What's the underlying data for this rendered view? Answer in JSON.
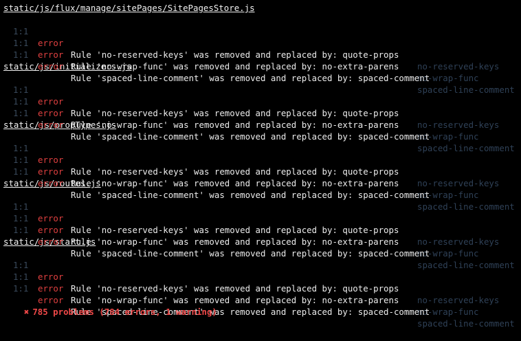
{
  "terminal": {
    "files": [
      {
        "path": "static/js/flux/manage/sitePages/SitePagesStore.js",
        "messages": [
          {
            "pos": "1:1",
            "severity": "error",
            "text": "Rule 'no-reserved-keys' was removed and replaced by: quote-props",
            "rule": "no-reserved-keys"
          },
          {
            "pos": "1:1",
            "severity": "error",
            "text": "Rule 'no-wrap-func' was removed and replaced by: no-extra-parens",
            "rule": "no-wrap-func"
          },
          {
            "pos": "1:1",
            "severity": "error",
            "text": "Rule 'spaced-line-comment' was removed and replaced by: spaced-comment",
            "rule": "spaced-line-comment"
          }
        ]
      },
      {
        "path": "static/js/initializers.js",
        "messages": [
          {
            "pos": "1:1",
            "severity": "error",
            "text": "Rule 'no-reserved-keys' was removed and replaced by: quote-props",
            "rule": "no-reserved-keys"
          },
          {
            "pos": "1:1",
            "severity": "error",
            "text": "Rule 'no-wrap-func' was removed and replaced by: no-extra-parens",
            "rule": "no-wrap-func"
          },
          {
            "pos": "1:1",
            "severity": "error",
            "text": "Rule 'spaced-line-comment' was removed and replaced by: spaced-comment",
            "rule": "spaced-line-comment"
          }
        ]
      },
      {
        "path": "static/js/propTypes.js",
        "messages": [
          {
            "pos": "1:1",
            "severity": "error",
            "text": "Rule 'no-reserved-keys' was removed and replaced by: quote-props",
            "rule": "no-reserved-keys"
          },
          {
            "pos": "1:1",
            "severity": "error",
            "text": "Rule 'no-wrap-func' was removed and replaced by: no-extra-parens",
            "rule": "no-wrap-func"
          },
          {
            "pos": "1:1",
            "severity": "error",
            "text": "Rule 'spaced-line-comment' was removed and replaced by: spaced-comment",
            "rule": "spaced-line-comment"
          }
        ]
      },
      {
        "path": "static/js/routes.js",
        "messages": [
          {
            "pos": "1:1",
            "severity": "error",
            "text": "Rule 'no-reserved-keys' was removed and replaced by: quote-props",
            "rule": "no-reserved-keys"
          },
          {
            "pos": "1:1",
            "severity": "error",
            "text": "Rule 'no-wrap-func' was removed and replaced by: no-extra-parens",
            "rule": "no-wrap-func"
          },
          {
            "pos": "1:1",
            "severity": "error",
            "text": "Rule 'spaced-line-comment' was removed and replaced by: spaced-comment",
            "rule": "spaced-line-comment"
          }
        ]
      },
      {
        "path": "static/js/start.js",
        "messages": [
          {
            "pos": "1:1",
            "severity": "error",
            "text": "Rule 'no-reserved-keys' was removed and replaced by: quote-props",
            "rule": "no-reserved-keys"
          },
          {
            "pos": "1:1",
            "severity": "error",
            "text": "Rule 'no-wrap-func' was removed and replaced by: no-extra-parens",
            "rule": "no-wrap-func"
          },
          {
            "pos": "1:1",
            "severity": "error",
            "text": "Rule 'spaced-line-comment' was removed and replaced by: spaced-comment",
            "rule": "spaced-line-comment"
          }
        ]
      }
    ],
    "summary": {
      "icon": "✖",
      "icon_name": "cross-icon",
      "text": "785 problems (784 errors, 1 warning)"
    },
    "colors": {
      "background": "#000000",
      "error": "#e04040",
      "summary": "#ef4848",
      "position": "#3a4a5c",
      "rule_id": "#2f4157",
      "text": "#ececec"
    }
  }
}
